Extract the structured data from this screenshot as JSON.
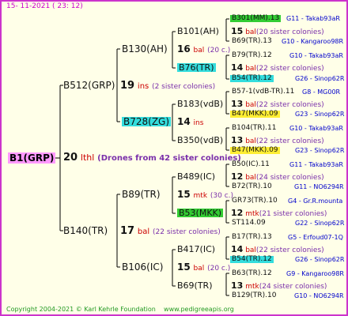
{
  "header": {
    "date": "15- 11-2021 ( 23: 12)"
  },
  "root": {
    "id": "B1(GRP)",
    "count": "20",
    "race": "lthl",
    "note": "(Drones from 42 sister colonies)"
  },
  "gen1": [
    {
      "id": "B512(GRP)",
      "count": "19",
      "race": "ins",
      "note": "(2 sister colonies)"
    },
    {
      "id": "B140(TR)",
      "count": "17",
      "race": "bal",
      "note": "(22 sister colonies)"
    }
  ],
  "gen2": [
    {
      "id": "B130(AH)",
      "count": "16",
      "race": "bal",
      "note": "(20 c.)"
    },
    {
      "id": "B728(ZG)",
      "count": "14",
      "race": "ins",
      "note": ""
    },
    {
      "id": "B89(TR)",
      "count": "15",
      "race": "mtk",
      "note": "(30 c.)"
    },
    {
      "id": "B106(IC)",
      "count": "15",
      "race": "bal",
      "note": "(20 c.)"
    }
  ],
  "gen3": [
    {
      "id": "B101(AH)",
      "count": "15",
      "race": "bal",
      "note": "(20 sister colonies)"
    },
    {
      "id": "B76(TR)",
      "count": "14",
      "race": "bal",
      "note": "(22 sister colonies)"
    },
    {
      "id": "B183(vdB)",
      "count": "13",
      "race": "bal",
      "note": "(22 sister colonies)"
    },
    {
      "id": "B350(vdB)",
      "count": "13",
      "race": "bal",
      "note": "(22 sister colonies)"
    },
    {
      "id": "B489(IC)",
      "count": "12",
      "race": "bal",
      "note": "(24 sister colonies)"
    },
    {
      "id": "B53(MKK)",
      "count": "12",
      "race": "mtk",
      "note": "(21 sister colonies)"
    },
    {
      "id": "B417(IC)",
      "count": "14",
      "race": "bal",
      "note": "(22 sister colonies)"
    },
    {
      "id": "B69(TR)",
      "count": "13",
      "race": "mtk",
      "note": "(24 sister colonies)"
    }
  ],
  "gen4": [
    {
      "id": "B301(MM).13",
      "colony": "G11 - Takab93aR"
    },
    {
      "id": "B69(TR).13",
      "colony": "G10 - Kangaroo98R"
    },
    {
      "id": "B79(TR).12",
      "colony": "G10 - Takab93aR"
    },
    {
      "id": "B54(TR).12",
      "colony": "G26 - Sinop62R"
    },
    {
      "id": "B57-1(vdB-TR).11",
      "colony": "G8 - MG00R"
    },
    {
      "id": "B47(MKK).09",
      "colony": "G23 - Sinop62R"
    },
    {
      "id": "B104(TR).11",
      "colony": "G10 - Takab93aR"
    },
    {
      "id": "B47(MKK).09",
      "colony": "G23 - Sinop62R"
    },
    {
      "id": "B50(IC).11",
      "colony": "G11 - Takab93aR"
    },
    {
      "id": "B72(TR).10",
      "colony": "G11 - NO6294R"
    },
    {
      "id": "GR73(TR).10",
      "colony": "G4 - Gr.R.mounta"
    },
    {
      "id": "ST114.09",
      "colony": "G22 - Sinop62R"
    },
    {
      "id": "B17(TR).13",
      "colony": "G5 - Erfoud07-1Q"
    },
    {
      "id": "B54(TR).12",
      "colony": "G26 - Sinop62R"
    },
    {
      "id": "B63(TR).12",
      "colony": "G9 - Kangaroo98R"
    },
    {
      "id": "B129(TR).10",
      "colony": "G10 - NO6294R"
    }
  ],
  "footer": {
    "copyright": "Copyright 2004-2021 © Karl Kehrle Foundation",
    "url": "www.pedigreeapis.org"
  }
}
